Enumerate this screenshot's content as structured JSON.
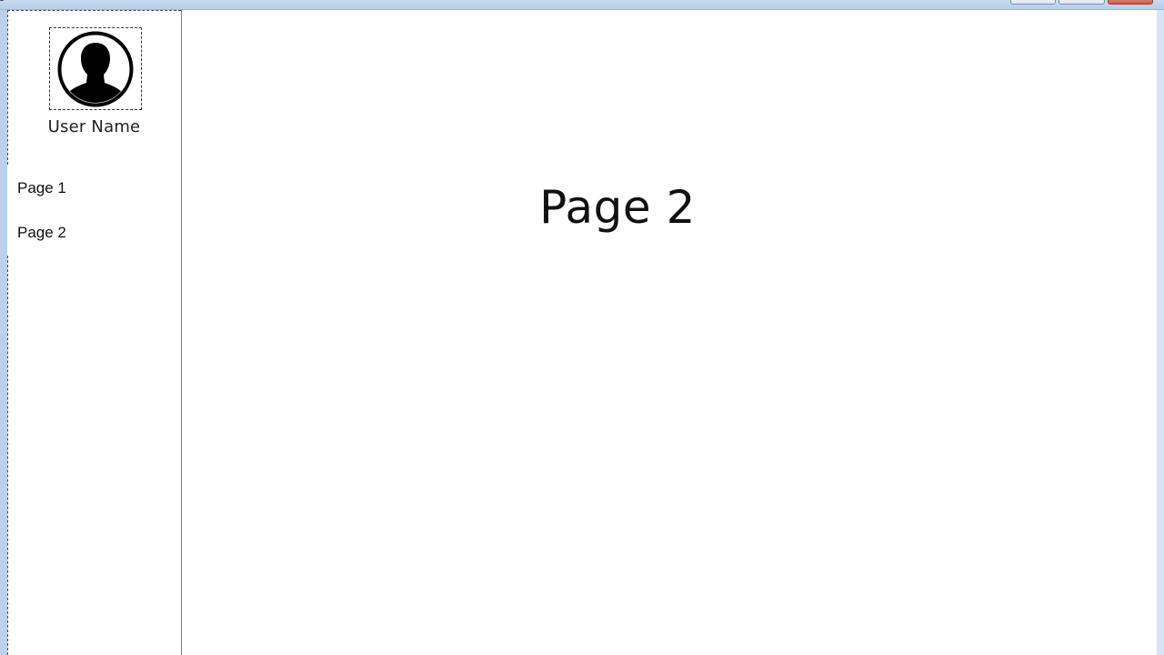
{
  "window": {
    "controls": {
      "minimize_icon": "minimize-icon",
      "maximize_icon": "maximize-icon",
      "close_icon": "close-icon",
      "close_color": "#c85d48"
    }
  },
  "sidebar": {
    "avatar_icon": "user-silhouette-icon",
    "user_name": "User Name",
    "items": [
      {
        "label": "Page 1"
      },
      {
        "label": "Page 2"
      }
    ]
  },
  "main": {
    "title": "Page 2"
  },
  "colors": {
    "frame": "#b9d1ea",
    "text": "#111111",
    "background": "#ffffff"
  }
}
